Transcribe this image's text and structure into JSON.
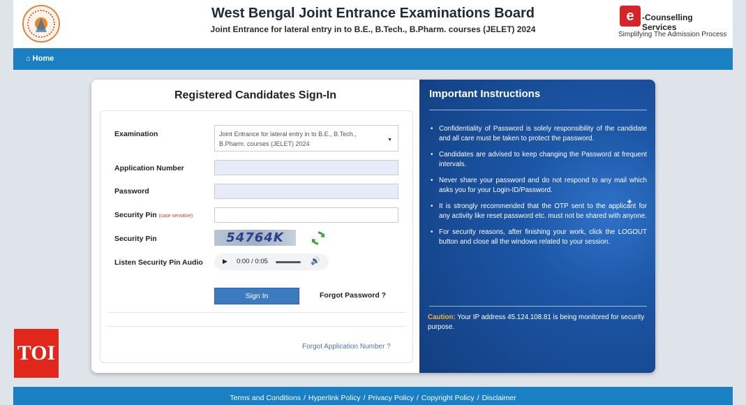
{
  "header": {
    "title": "West Bengal Joint Entrance Examinations Board",
    "subtitle": "Joint Entrance for lateral entry in to B.E., B.Tech., B.Pharm. courses (JELET) 2024",
    "logo_right_mark": "e",
    "logo_right_name": "-Counselling Services",
    "logo_right_tagline": "Simplifying The Admission Process"
  },
  "nav": {
    "home": "Home"
  },
  "signin": {
    "title": "Registered Candidates Sign-In",
    "examination_label": "Examination",
    "examination_value": "Joint Entrance for lateral entry in to B.E., B.Tech., B.Pharm. courses (JELET) 2024",
    "application_label": "Application Number",
    "application_value": "",
    "password_label": "Password",
    "password_value": "",
    "security_pin_label": "Security Pin",
    "case_sensitive": "(case sensitive)",
    "security_pin_value": "",
    "captcha_label": "Security Pin",
    "captcha_text": "54764K",
    "audio_label": "Listen Security Pin Audio",
    "audio_time": "0:00 / 0:05",
    "signin_button": "Sign In",
    "forgot_password": "Forgot Password ?",
    "forgot_application": "Forgot Application Number ?"
  },
  "instructions": {
    "title": "Important Instructions",
    "items": [
      "Confidentiality of Password is solely responsibility of the candidate and all care must be taken to protect the password.",
      "Candidates are advised to keep changing the Password at frequent intervals.",
      "Never share your password and do not respond to any mail which asks you for your Login-ID/Password.",
      "It is strongly recommended that the OTP sent to the applicant for any activity like reset password etc. must not be shared with anyone.",
      "For security reasons, after finishing your work, click the LOGOUT button and close all the windows related to your session."
    ],
    "caution_label": "Caution:",
    "caution_text": " Your IP address 45.124.108.81 is being monitored for security purpose."
  },
  "footer": {
    "links": [
      "Terms and Conditions",
      "Hyperlink Policy",
      "Privacy Policy",
      "Copyright Policy",
      "Disclaimer"
    ],
    "separator": "/"
  },
  "watermark": "TOI",
  "colors": {
    "nav_blue": "#1a7fc3",
    "panel_blue": "#1c56a6",
    "signin_button": "#3c7bc0",
    "caution": "#f3b23a",
    "toi_red": "#e1261c"
  }
}
